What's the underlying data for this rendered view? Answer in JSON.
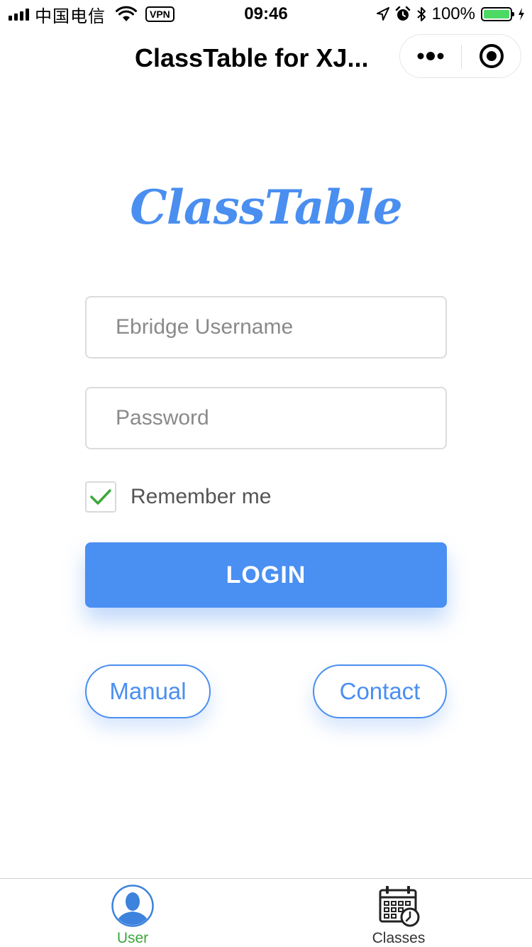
{
  "status_bar": {
    "carrier": "中国电信",
    "vpn": "VPN",
    "time": "09:46",
    "battery": "100%",
    "battery_level": 1.0,
    "battery_color": "#4cd964"
  },
  "nav": {
    "title": "ClassTable for XJ...",
    "more_icon": "more-dots-icon",
    "close_icon": "target-close-icon"
  },
  "logo": {
    "text": "ClassTable",
    "color": "#4a8ff0"
  },
  "form": {
    "username_placeholder": "Ebridge Username",
    "username_value": "",
    "password_placeholder": "Password",
    "password_value": "",
    "remember_label": "Remember me",
    "remember_checked": true,
    "login_label": "LOGIN"
  },
  "links": {
    "manual_label": "Manual",
    "contact_label": "Contact"
  },
  "tabbar": {
    "tabs": [
      {
        "label": "User",
        "icon": "user-avatar-icon",
        "active": true,
        "color": "#3ca73c"
      },
      {
        "label": "Classes",
        "icon": "calendar-clock-icon",
        "active": false,
        "color": "#333333"
      }
    ]
  },
  "colors": {
    "accent": "#4a8ff2",
    "checkbox_check": "#3ca73c"
  }
}
